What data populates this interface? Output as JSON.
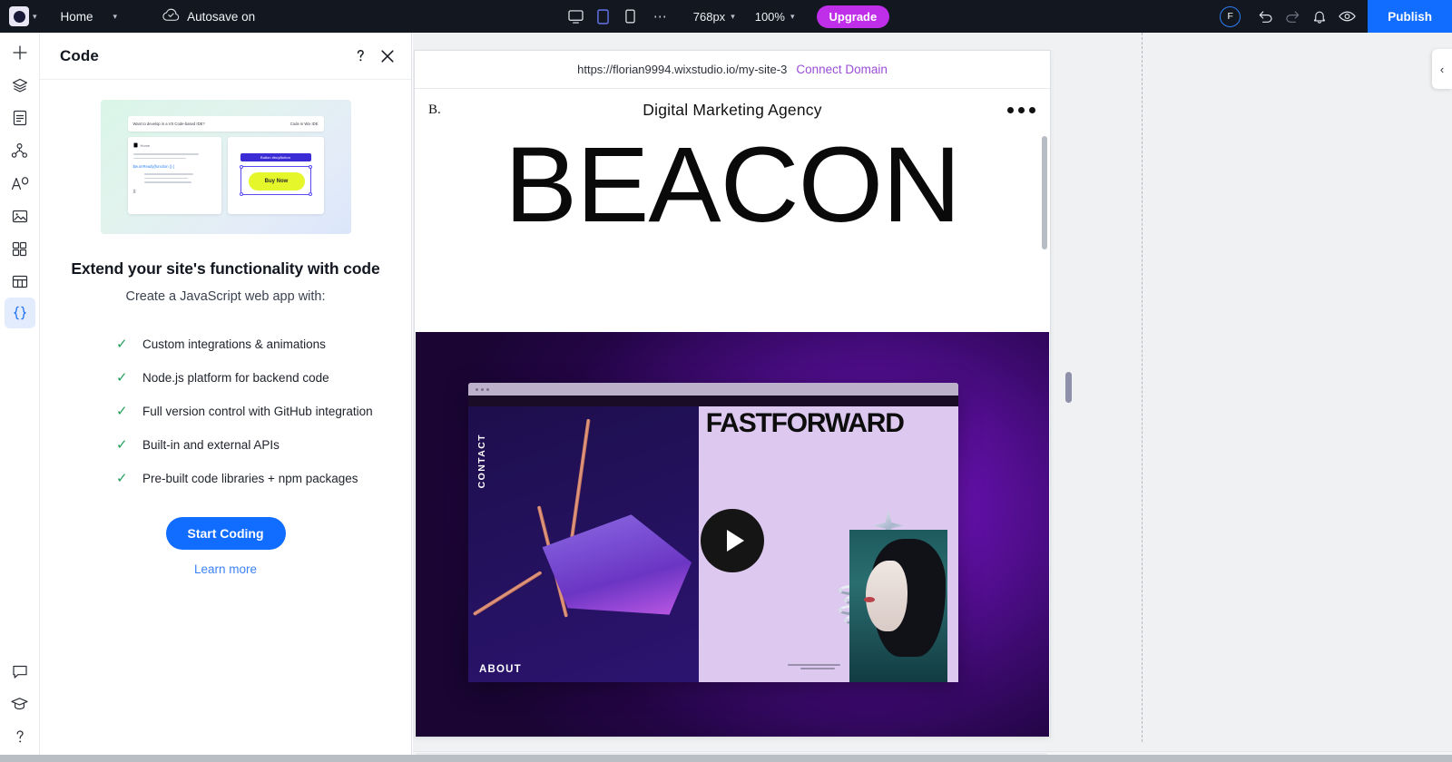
{
  "topbar": {
    "logo_icon": "wix-logo-icon",
    "logo_chevron_icon": "chevron-down-icon",
    "page_selector": {
      "label": "Home",
      "chevron_icon": "chevron-down-icon"
    },
    "autosave": {
      "label": "Autosave on",
      "icon": "cloud-check-icon"
    },
    "viewports": [
      {
        "name": "desktop",
        "icon": "desktop-icon",
        "active": false
      },
      {
        "name": "tablet",
        "icon": "tablet-icon",
        "active": true
      },
      {
        "name": "mobile",
        "icon": "mobile-icon",
        "active": false
      }
    ],
    "more_icon": "more-horizontal-icon",
    "breakpoint": {
      "value": "768px",
      "chevron_icon": "chevron-down-icon"
    },
    "zoom": {
      "value": "100%",
      "chevron_icon": "chevron-down-icon"
    },
    "upgrade_label": "Upgrade",
    "avatar_initial": "F",
    "undo_icon": "undo-icon",
    "redo_icon": "redo-icon",
    "notifications_icon": "bell-icon",
    "preview_icon": "eye-icon",
    "publish_label": "Publish",
    "bg_color": "#131720",
    "accent_publish": "#116dff",
    "accent_upgrade": "#bf2ee8"
  },
  "rail": {
    "items": [
      {
        "name": "add",
        "icon": "plus-icon",
        "active": false
      },
      {
        "name": "layers",
        "icon": "layers-icon",
        "active": false
      },
      {
        "name": "pages",
        "icon": "page-icon",
        "active": false
      },
      {
        "name": "cms",
        "icon": "cms-nodes-icon",
        "active": false
      },
      {
        "name": "text",
        "icon": "text-style-icon",
        "active": false
      },
      {
        "name": "media",
        "icon": "image-icon",
        "active": false
      },
      {
        "name": "apps",
        "icon": "apps-grid-icon",
        "active": false
      },
      {
        "name": "tables",
        "icon": "table-icon",
        "active": false
      },
      {
        "name": "code",
        "icon": "curly-braces-icon",
        "active": true
      }
    ],
    "bottom_items": [
      {
        "name": "feedback",
        "icon": "chat-bubble-icon"
      },
      {
        "name": "learn",
        "icon": "graduation-cap-icon"
      },
      {
        "name": "help",
        "icon": "question-mark-icon"
      }
    ]
  },
  "panel": {
    "title": "Code",
    "help_icon": "question-mark-icon",
    "close_icon": "close-icon",
    "illustration": {
      "name": "code-ide-illustration",
      "topbar_text": "Want to develop in a VS Code-based IDE?",
      "topbar_action": "Code in Wix IDE",
      "file_label": "Home",
      "code_snippet": "$w.onReady(function () {",
      "code_snippet_end": "});",
      "element_label": "Button #buyButton",
      "button_label": "Buy Now"
    },
    "heading": "Extend your site's functionality with code",
    "subheading": "Create a JavaScript web app with:",
    "features": [
      "Custom integrations & animations",
      "Node.js platform for backend code",
      "Full version control with GitHub integration",
      "Built-in and external APIs",
      "Pre-built code libraries + npm packages"
    ],
    "check_icon": "check-icon",
    "check_color": "#23a05c",
    "cta_label": "Start Coding",
    "cta_color": "#116dff",
    "learn_more_label": "Learn more",
    "learn_more_color": "#3b82f6"
  },
  "stage": {
    "url": "https://florian9994.wixstudio.io/my-site-3",
    "connect_domain_label": "Connect Domain",
    "connect_domain_color": "#9a4dd6",
    "collapse_icon": "chevron-left-icon",
    "drag_handle_name": "resize-handle",
    "site": {
      "logo": "B.",
      "title": "Digital Marketing Agency",
      "menu_icon": "more-horizontal-icon",
      "hero_heading": "BEACON",
      "media": {
        "name": "hero-video",
        "play_icon": "play-icon",
        "inner_heading": "FASTFORWARD",
        "nav_contact": "CONTACT",
        "nav_about": "ABOUT"
      }
    }
  }
}
